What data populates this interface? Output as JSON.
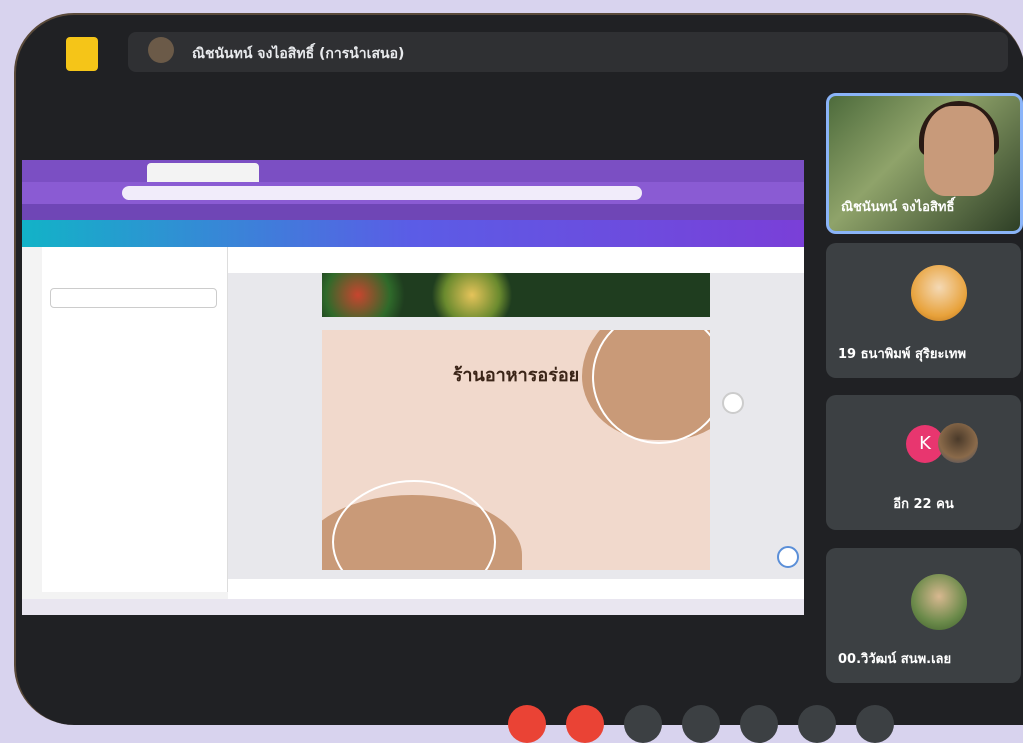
{
  "meeting": {
    "presenter_label": "ณิชนันทน์ จงไอสิทธิ์ (การนำเสนอ)"
  },
  "shared_screen": {
    "slide_title": "ร้านอาหารอร่อย"
  },
  "participants": [
    {
      "name": "ณิชนันทน์ จงไอสิทธิ์",
      "speaking": true
    },
    {
      "name": "19 ธนาพิมพ์ สุริยะเทพ",
      "speaking": false
    },
    {
      "more_badge": "K",
      "more_label": "อีก 22 คน"
    },
    {
      "name": "00.วิวัฒน์ สนพ.เลย",
      "speaking": false
    }
  ],
  "colors": {
    "accent_active": "#8ab4f8",
    "browser_theme": "#7b4fc3",
    "call_background": "#202124",
    "end_call": "#ea4335"
  }
}
